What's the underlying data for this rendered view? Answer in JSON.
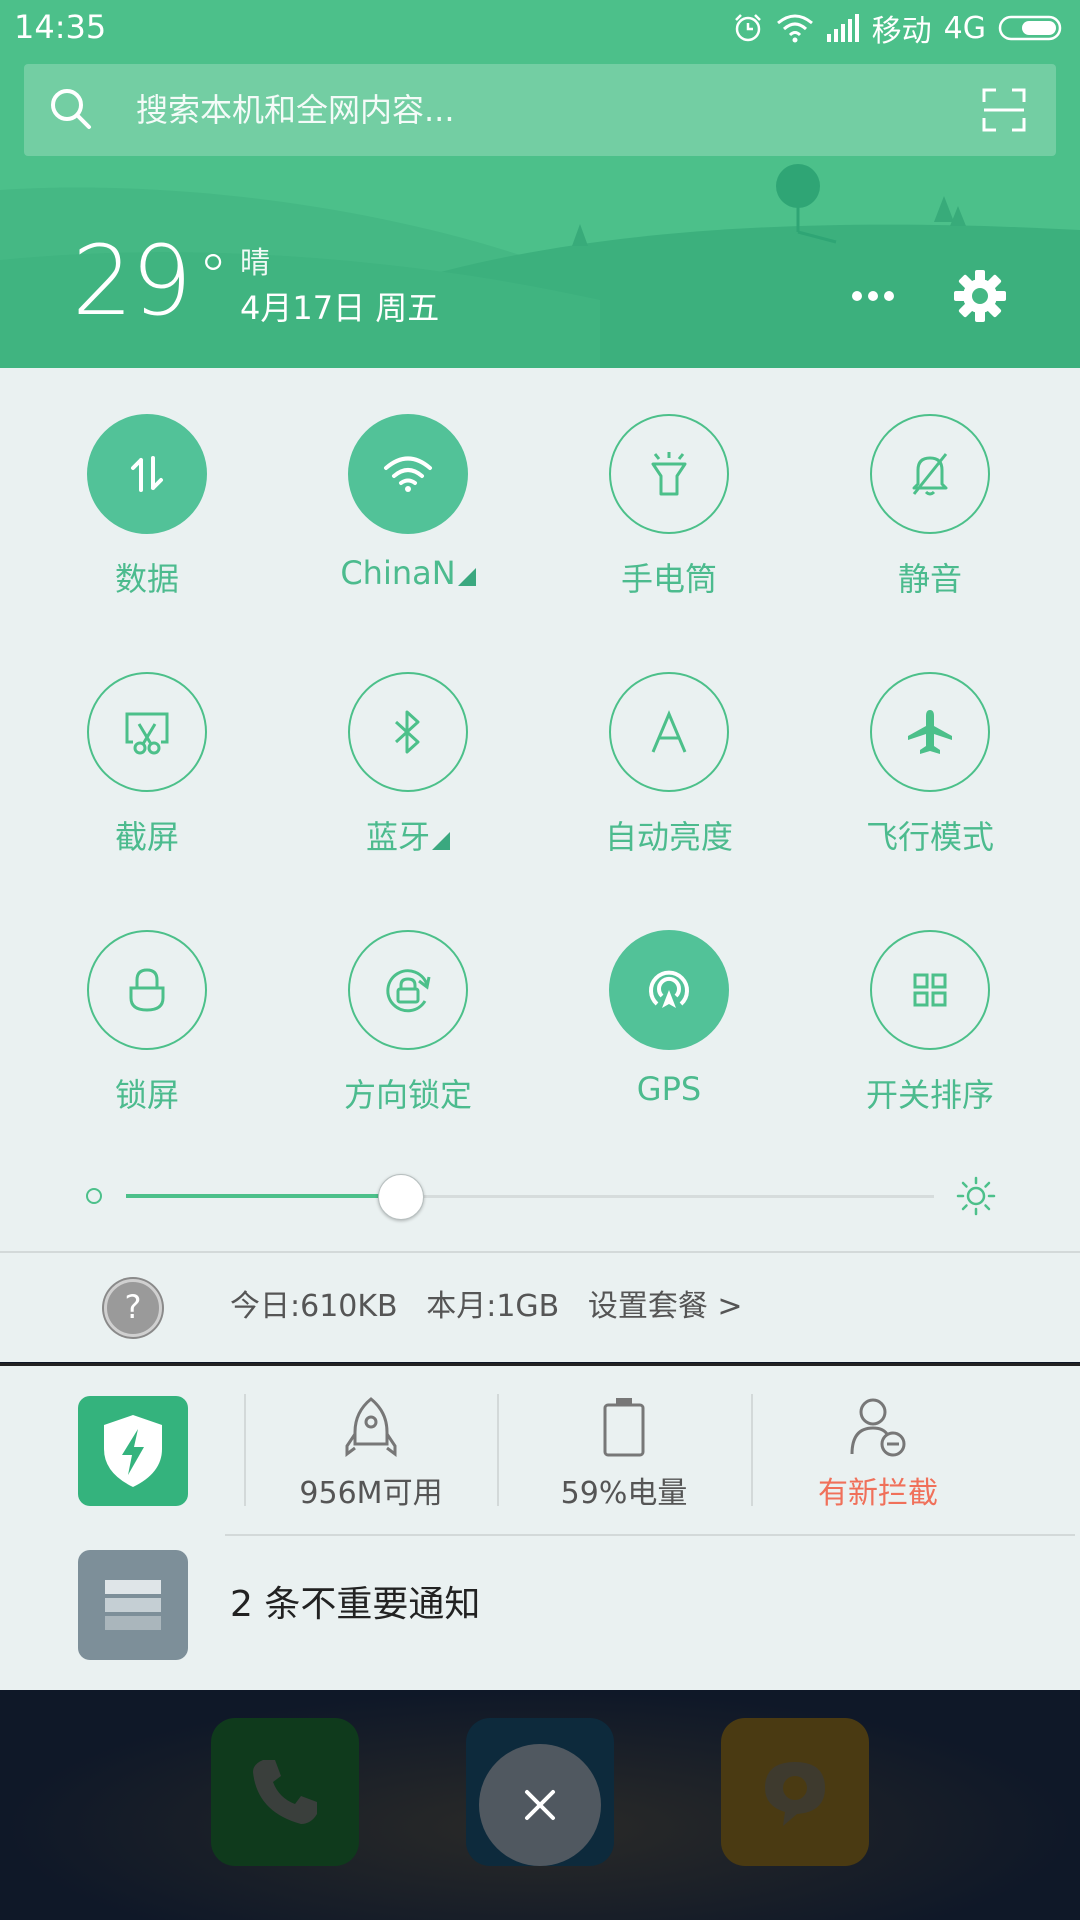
{
  "status_bar": {
    "time": "14:35",
    "carrier": "移动",
    "network": "4G"
  },
  "search": {
    "placeholder": "搜索本机和全网内容..."
  },
  "weather": {
    "temperature": "29",
    "degree_symbol": "°",
    "condition": "晴",
    "date": "4月17日 周五"
  },
  "toggles": [
    {
      "label": "数据",
      "state": "on",
      "icon": "data-arrows-icon"
    },
    {
      "label": "ChinaN",
      "state": "on",
      "icon": "wifi-icon",
      "has_arrow": true
    },
    {
      "label": "手电筒",
      "state": "off",
      "icon": "flashlight-icon"
    },
    {
      "label": "静音",
      "state": "off",
      "icon": "bell-off-icon"
    },
    {
      "label": "截屏",
      "state": "off",
      "icon": "screenshot-icon"
    },
    {
      "label": "蓝牙",
      "state": "off",
      "icon": "bluetooth-icon",
      "has_arrow": true
    },
    {
      "label": "自动亮度",
      "state": "off",
      "icon": "auto-brightness-icon"
    },
    {
      "label": "飞行模式",
      "state": "off",
      "icon": "airplane-icon"
    },
    {
      "label": "锁屏",
      "state": "off",
      "icon": "lock-icon"
    },
    {
      "label": "方向锁定",
      "state": "off",
      "icon": "rotation-lock-icon"
    },
    {
      "label": "GPS",
      "state": "on",
      "icon": "gps-icon"
    },
    {
      "label": "开关排序",
      "state": "off",
      "icon": "grid-icon"
    }
  ],
  "brightness": {
    "level": 0.34
  },
  "data_usage": {
    "today": "今日:610KB",
    "month": "本月:1GB",
    "setup": "设置套餐 >"
  },
  "security": {
    "memory": "956M可用",
    "battery": "59%电量",
    "blocked": "有新拦截"
  },
  "notifications": {
    "unimportant": "2 条不重要通知"
  },
  "colors": {
    "accent": "#4cc08a",
    "warning": "#f0705a",
    "panel_bg": "#eaf1f1"
  }
}
